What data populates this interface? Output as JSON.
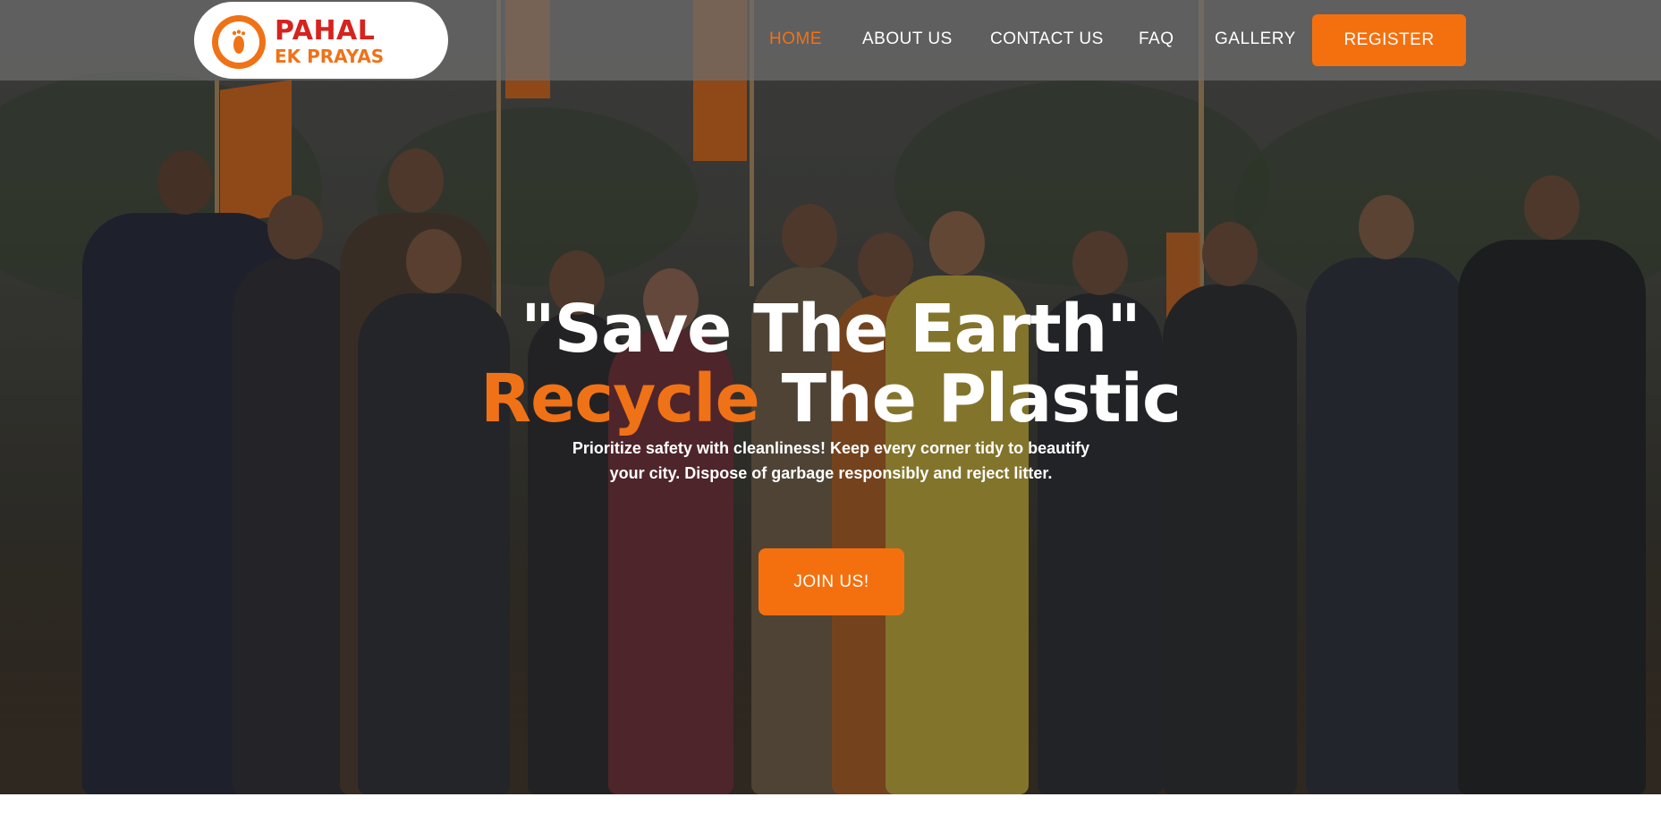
{
  "brand": {
    "name": "PAHAL",
    "tagline": "EK PRAYAS",
    "logo_icon": "footprint-icon",
    "primary_color": "#f07217",
    "name_color": "#d6231e"
  },
  "nav": {
    "items": [
      {
        "label": "HOME",
        "active": true
      },
      {
        "label": "ABOUT US",
        "active": false
      },
      {
        "label": "CONTACT US",
        "active": false
      },
      {
        "label": "FAQ",
        "active": false
      },
      {
        "label": "GALLERY",
        "active": false
      }
    ],
    "register_label": "REGISTER"
  },
  "hero": {
    "headline_line1": "\"Save The Earth\"",
    "headline_accent": "Recycle",
    "headline_rest": " The Plastic",
    "description": "Prioritize safety with cleanliness! Keep every corner tidy to beautify your city. Dispose of garbage responsibly and reject litter.",
    "cta_label": "JOIN US!",
    "background": "group-photo-volunteers"
  }
}
